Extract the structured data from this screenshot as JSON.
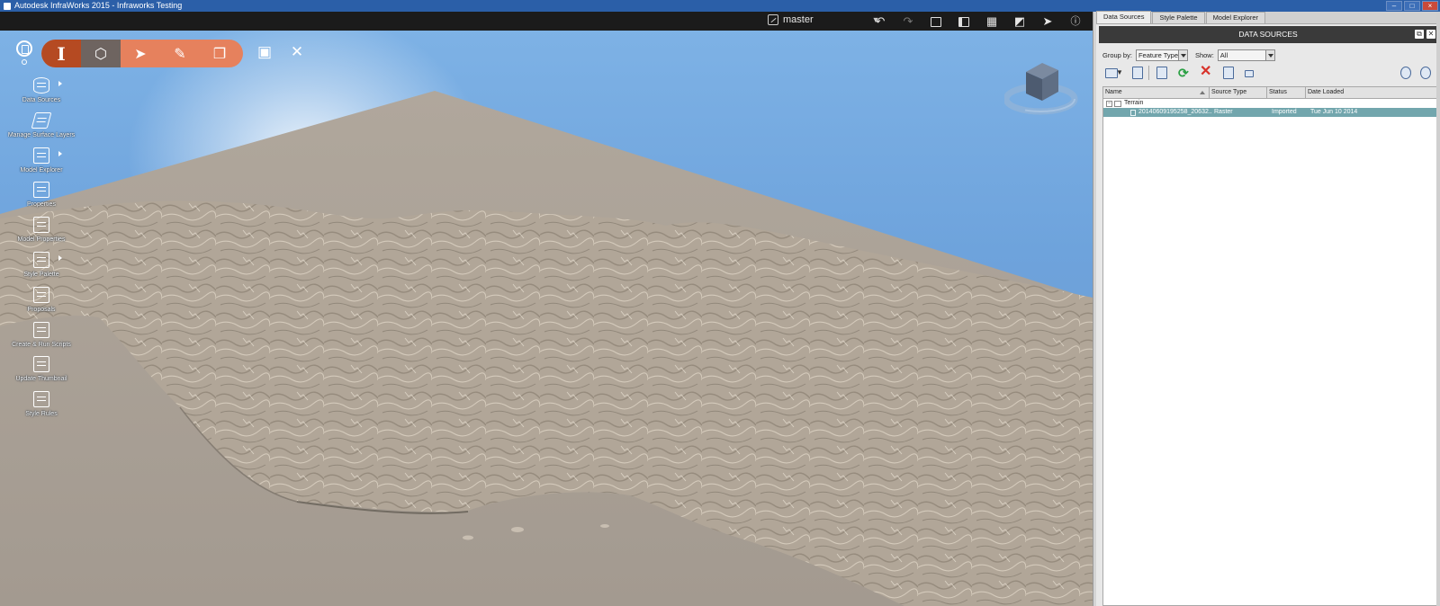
{
  "window": {
    "title": "Autodesk InfraWorks 2015 - Infraworks Testing"
  },
  "topbar": {
    "branch": "master"
  },
  "left_panel": {
    "items": [
      {
        "label": "Data Sources",
        "icon": "database-icon",
        "arrow": true
      },
      {
        "label": "Manage Surface Layers",
        "icon": "layers-icon",
        "arrow": false
      },
      {
        "label": "Model Explorer",
        "icon": "model-explorer-icon",
        "arrow": true
      },
      {
        "label": "Properties",
        "icon": "properties-icon",
        "arrow": false
      },
      {
        "label": "Model Properties",
        "icon": "model-properties-icon",
        "arrow": false
      },
      {
        "label": "Style Palette",
        "icon": "style-palette-icon",
        "arrow": true
      },
      {
        "label": "Proposals",
        "icon": "proposals-icon",
        "arrow": false
      },
      {
        "label": "Create & Run Scripts",
        "icon": "script-icon",
        "arrow": false
      },
      {
        "label": "Update Thumbnail",
        "icon": "thumbnail-icon",
        "arrow": false
      },
      {
        "label": "Style Rules",
        "icon": "style-rules-icon",
        "arrow": false
      }
    ]
  },
  "right_panel": {
    "tabs": [
      {
        "label": "Data Sources",
        "active": true
      },
      {
        "label": "Style Palette",
        "active": false
      },
      {
        "label": "Model Explorer",
        "active": false
      }
    ],
    "header": "DATA SOURCES",
    "group_by_label": "Group by:",
    "group_by_value": "Feature Type",
    "show_label": "Show:",
    "show_value": "All",
    "table": {
      "columns": [
        "Name",
        "Source Type",
        "Status",
        "Date Loaded"
      ],
      "group": "Terrain",
      "rows": [
        {
          "name": "20140609195258_20632...",
          "source_type": "Raster",
          "status": "Imported",
          "date_loaded": "Tue Jun 10 2014"
        }
      ]
    }
  },
  "colors": {
    "accent_orange": "#e6815d",
    "selected_row": "#72a6ad",
    "sky": "#6ea3dc",
    "terrain": "#a49a8f"
  }
}
